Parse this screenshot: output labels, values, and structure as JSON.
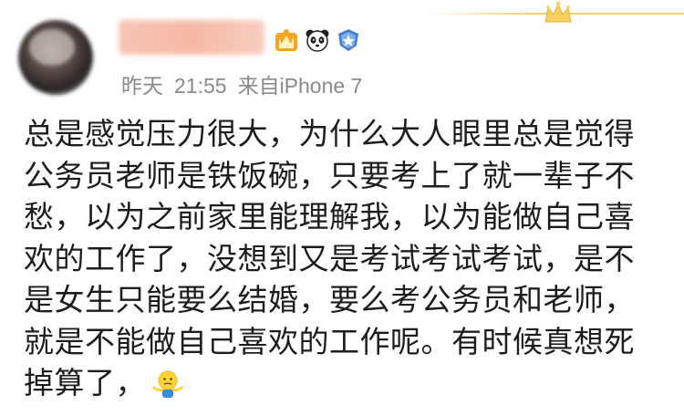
{
  "post": {
    "meta": {
      "date": "昨天",
      "time": "21:55",
      "source": "来自iPhone 7"
    },
    "lines": [
      "总是感觉压力很大，为什么大人眼里总是觉得",
      "公务员老师是铁饭碗，只要考上了就一辈子不",
      "愁，以为之前家里能理解我，以为能做自己喜",
      "欢的工作了，没想到又是考试考试考试，是不",
      "是女生只能要么结婚，要么考公务员和老师，",
      "就是不能做自己喜欢的工作呢。有时候真想死",
      "掉算了，"
    ],
    "emoji": "shrug-emoji",
    "badges": [
      "vip-crown-badge",
      "panda-badge",
      "level-badge"
    ]
  },
  "colors": {
    "name_blur": "#f5b9a5",
    "meta": "#8a8a8a",
    "text": "#1d1d1d",
    "crown": "#f2cf6e"
  }
}
